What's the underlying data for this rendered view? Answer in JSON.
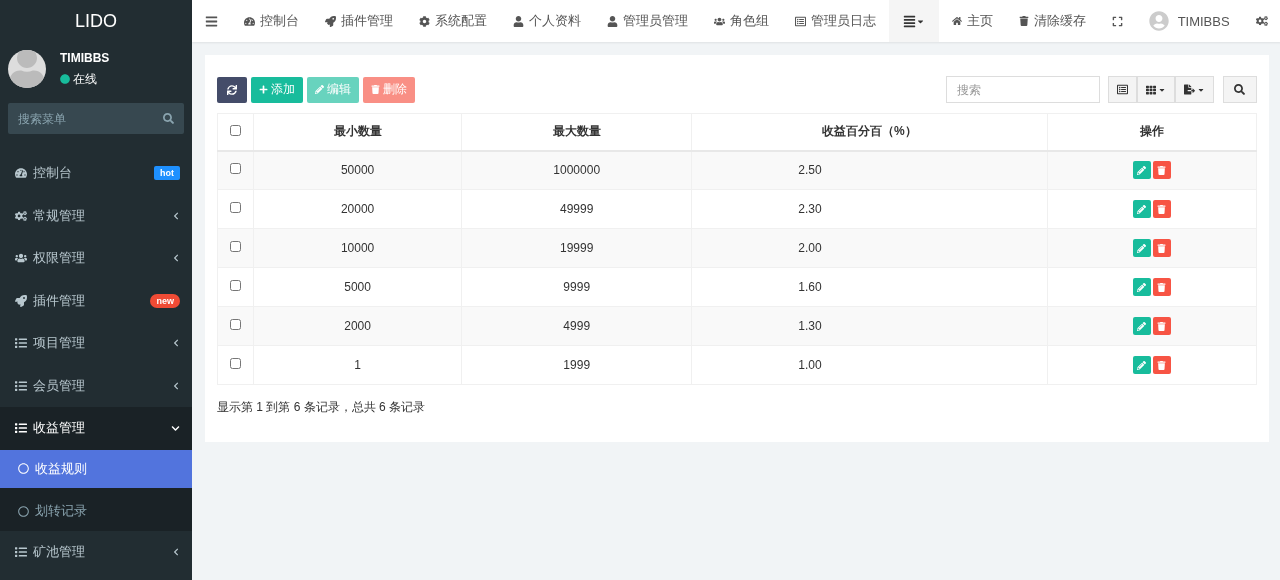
{
  "sidebar": {
    "logo": "LIDO",
    "user": {
      "name": "TIMIBBS",
      "status": "在线"
    },
    "search": {
      "placeholder": "搜索菜单"
    },
    "items": [
      {
        "label": "控制台",
        "badge": {
          "text": "hot",
          "color": "#1e90ff"
        }
      },
      {
        "label": "常规管理",
        "expanded": false
      },
      {
        "label": "权限管理",
        "expanded": false
      },
      {
        "label": "插件管理",
        "badge": {
          "text": "new",
          "color": "#f04b35"
        }
      },
      {
        "label": "项目管理",
        "expanded": false
      },
      {
        "label": "会员管理",
        "expanded": false
      },
      {
        "label": "收益管理",
        "expanded": true,
        "children": [
          {
            "label": "收益规则",
            "selected": true
          },
          {
            "label": "划转记录",
            "selected": false
          }
        ]
      },
      {
        "label": "矿池管理",
        "expanded": false
      }
    ]
  },
  "topbar": {
    "tabs": [
      "控制台",
      "插件管理",
      "系统配置",
      "个人资料",
      "管理员管理",
      "角色组",
      "管理员日志"
    ],
    "right": [
      "主页",
      "清除缓存"
    ],
    "user": "TIMIBBS"
  },
  "toolbar": {
    "buttons": [
      {
        "label": "添加",
        "disabled": false
      },
      {
        "label": "编辑",
        "disabled": true
      },
      {
        "label": "删除",
        "disabled": true
      }
    ],
    "search": {
      "placeholder": "搜索"
    }
  },
  "table": {
    "columns": [
      "最小数量",
      "最大数量",
      "收益百分百（%）",
      "操作"
    ],
    "header_checked": false,
    "rows": [
      {
        "checked": false,
        "cells": [
          "50000",
          "1000000",
          "2.50"
        ]
      },
      {
        "checked": false,
        "cells": [
          "20000",
          "49999",
          "2.30"
        ]
      },
      {
        "checked": false,
        "cells": [
          "10000",
          "19999",
          "2.00"
        ]
      },
      {
        "checked": false,
        "cells": [
          "5000",
          "9999",
          "1.60"
        ]
      },
      {
        "checked": false,
        "cells": [
          "2000",
          "4999",
          "1.30"
        ]
      },
      {
        "checked": false,
        "cells": [
          "1",
          "1999",
          "1.00"
        ]
      }
    ]
  },
  "footer": "显示第 1 到第 6 条记录，总共 6 条记录"
}
